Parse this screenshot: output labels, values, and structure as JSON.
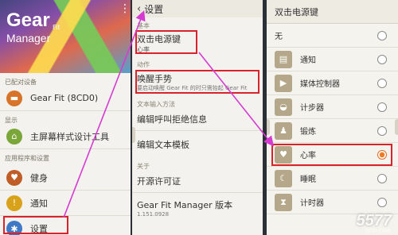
{
  "panel1": {
    "app_title": "Gear",
    "app_title_fit": "Fit",
    "app_subtitle": "Manager",
    "menu_icon": "more-vertical-icon",
    "sections": {
      "connected": "已配对设备",
      "display": "显示",
      "apps": "应用程序和设置"
    },
    "device_name": "Gear Fit (8CD0)",
    "home_screen": "主屏幕样式设计工具",
    "items": [
      {
        "label": "健身",
        "icon": "fitness-icon",
        "color": "#c05c26"
      },
      {
        "label": "通知",
        "icon": "notification-icon",
        "color": "#d8a31a"
      },
      {
        "label": "设置",
        "icon": "gear-icon",
        "color": "#3f79c6"
      }
    ]
  },
  "panel2": {
    "title": "设置",
    "back_icon": "chevron-left-icon",
    "sec_basic": "基本",
    "double_press": "双击电源键",
    "double_press_value": "心率",
    "sec_motion": "动作",
    "wake_gesture": "唤醒手势",
    "wake_gesture_desc": "要启动唤醒 Gear Fit 的时只需抬起 Gear Fit",
    "sec_text": "文本输入方法",
    "edit_reject": "编辑呼叫拒绝信息",
    "edit_text": "编辑文本模板",
    "sec_about": "关于",
    "license": "开源许可证",
    "version_label": "Gear Fit Manager 版本",
    "version_value": "1.151.0928"
  },
  "panel3": {
    "title": "双击电源键",
    "options": [
      {
        "label": "无",
        "icon": "",
        "selected": false
      },
      {
        "label": "通知",
        "icon": "notification-icon",
        "selected": false
      },
      {
        "label": "媒体控制器",
        "icon": "play-icon",
        "selected": false
      },
      {
        "label": "计步器",
        "icon": "shoe-icon",
        "selected": false
      },
      {
        "label": "锻炼",
        "icon": "runner-icon",
        "selected": false
      },
      {
        "label": "心率",
        "icon": "heart-icon",
        "selected": true
      },
      {
        "label": "睡眠",
        "icon": "moon-icon",
        "selected": false
      },
      {
        "label": "计时器",
        "icon": "hourglass-icon",
        "selected": false
      }
    ]
  },
  "watermark": {
    "text": "5577",
    "sub": "5577.COM"
  },
  "colors": {
    "highlight": "#d8232a",
    "arrow": "#d63bd1",
    "radio_on": "#f07b24",
    "icon_tan": "#b5a88a"
  }
}
